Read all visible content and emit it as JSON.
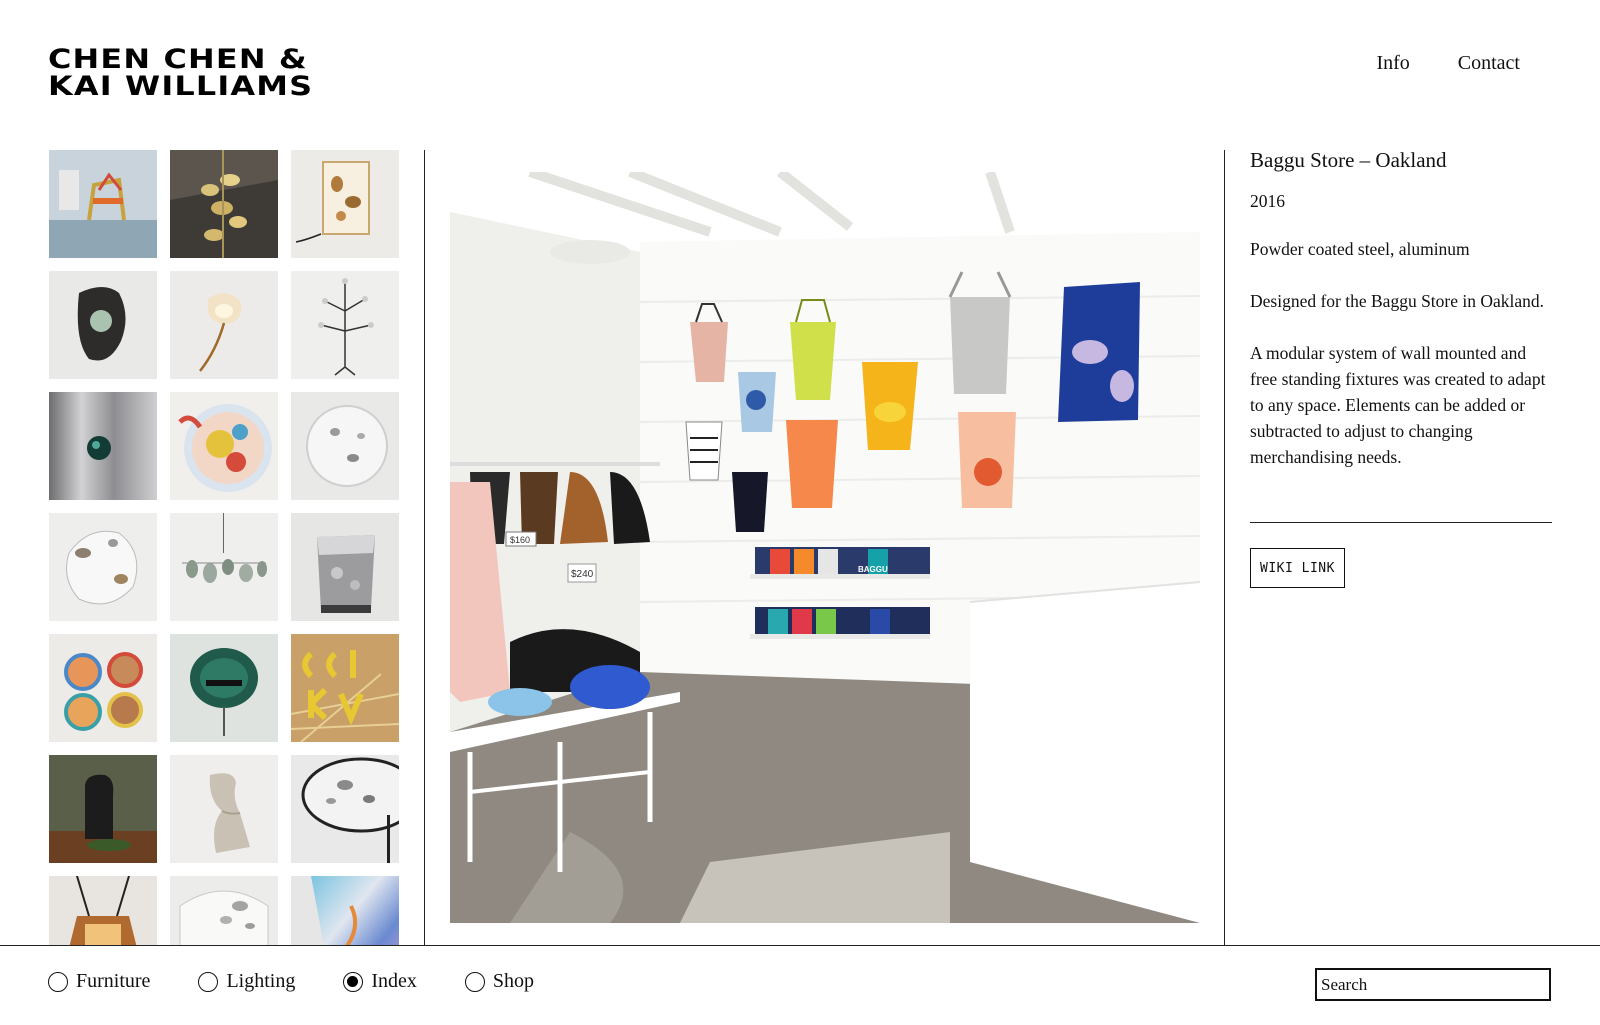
{
  "brand": {
    "line1": "CHEN CHEN &",
    "line2": "KAI WILLIAMS"
  },
  "nav": {
    "info": "Info",
    "contact": "Contact"
  },
  "thumbnails": [
    {
      "icon": "chair-sculpture-thumb"
    },
    {
      "icon": "gold-chandelier-thumb"
    },
    {
      "icon": "cube-lamp-thumb"
    },
    {
      "icon": "dark-mirror-thumb"
    },
    {
      "icon": "flower-lamp-thumb"
    },
    {
      "icon": "candelabra-thumb"
    },
    {
      "icon": "steel-panel-thumb"
    },
    {
      "icon": "painted-vessel-thumb"
    },
    {
      "icon": "white-dish-thumb"
    },
    {
      "icon": "stone-plate-thumb"
    },
    {
      "icon": "hanging-mobile-thumb"
    },
    {
      "icon": "silver-stool-thumb"
    },
    {
      "icon": "rope-coasters-thumb"
    },
    {
      "icon": "green-mirror-thumb"
    },
    {
      "icon": "straw-lettering-thumb"
    },
    {
      "icon": "black-chair-thumb"
    },
    {
      "icon": "wavy-chair-thumb"
    },
    {
      "icon": "glass-table-thumb"
    },
    {
      "icon": "pendant-lamp-thumb"
    },
    {
      "icon": "white-vase-thumb"
    },
    {
      "icon": "iridescent-panel-thumb"
    }
  ],
  "project": {
    "title": "Baggu Store – Oakland",
    "year": "2016",
    "materials": "Powder coated steel, aluminum",
    "summary": "Designed for the Baggu Store in Oakland.",
    "description": "A modular system of wall mounted and free standing fixtures was created to adapt to any space. Elements can be added or subtracted to adjust to changing merchandising needs.",
    "link_label": "WIKI LINK",
    "photo_labels": {
      "price_tag_1": "$160",
      "price_tag_2": "$240",
      "shelf_brand": "BAGGU"
    }
  },
  "filters": [
    {
      "label": "Furniture",
      "selected": false
    },
    {
      "label": "Lighting",
      "selected": false
    },
    {
      "label": "Index",
      "selected": true
    },
    {
      "label": "Shop",
      "selected": false
    }
  ],
  "search": {
    "placeholder": "Search"
  }
}
